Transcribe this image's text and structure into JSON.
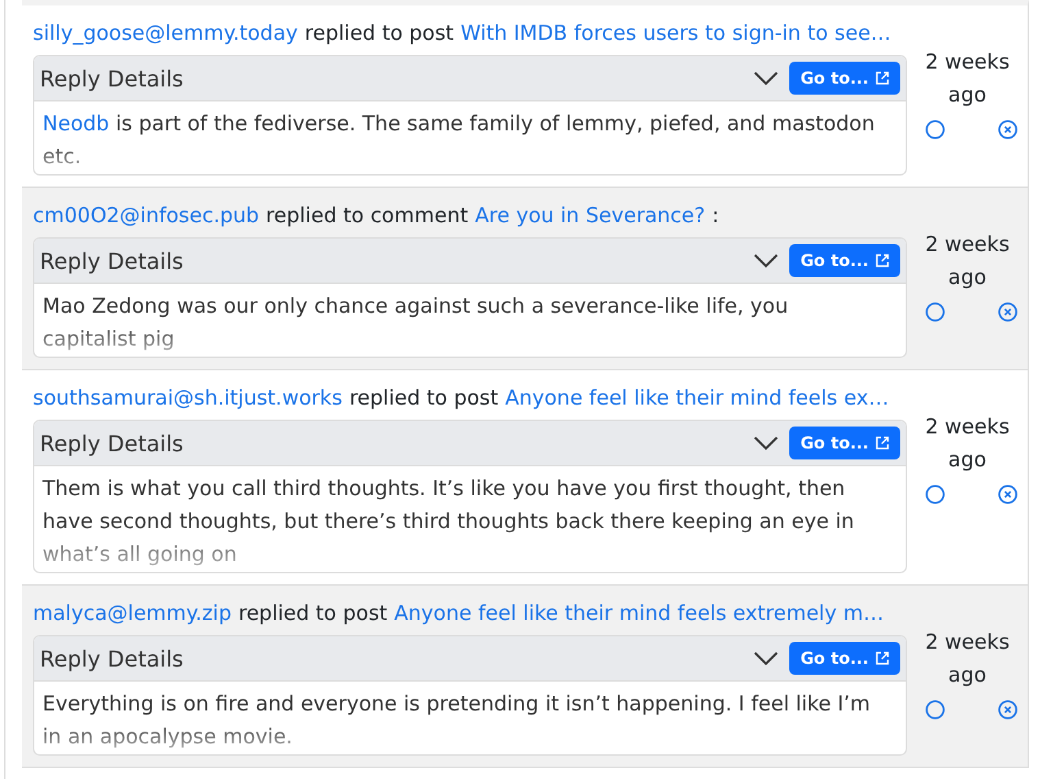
{
  "replies": [
    {
      "author": "silly_goose@lemmy.today",
      "action": "replied to post",
      "target": "With IMDB forces users to sign-in to see…",
      "details_label": "Reply Details",
      "goto_label": "Go to...",
      "body_link": "Neodb",
      "body": "is part of the fediverse. The same family of lemmy, piefed, and mastodon etc.",
      "time": "2 weeks ago"
    },
    {
      "author": "cm00O2@infosec.pub",
      "action": "replied to comment",
      "target": "Are you in Severance?",
      "suffix": ":",
      "details_label": "Reply Details",
      "goto_label": "Go to...",
      "body": "Mao Zedong was our only chance against such a severance-like life, you capitalist pig",
      "time": "2 weeks ago"
    },
    {
      "author": "southsamurai@sh.itjust.works",
      "action": "replied to post",
      "target": "Anyone feel like their mind feels ex…",
      "details_label": "Reply Details",
      "goto_label": "Go to...",
      "body": "Them is what you call third thoughts. It’s like you have you first thought, then have second thoughts, but there’s third thoughts back there keeping an eye in what’s all going on",
      "time": "2 weeks ago"
    },
    {
      "author": "malyca@lemmy.zip",
      "action": "replied to post",
      "target": "Anyone feel like their mind feels extremely m…",
      "details_label": "Reply Details",
      "goto_label": "Go to...",
      "body": "Everything is on fire and everyone is pretending it isn’t happening. I feel like I’m in an apocalypse movie.",
      "time": "2 weeks ago"
    }
  ]
}
